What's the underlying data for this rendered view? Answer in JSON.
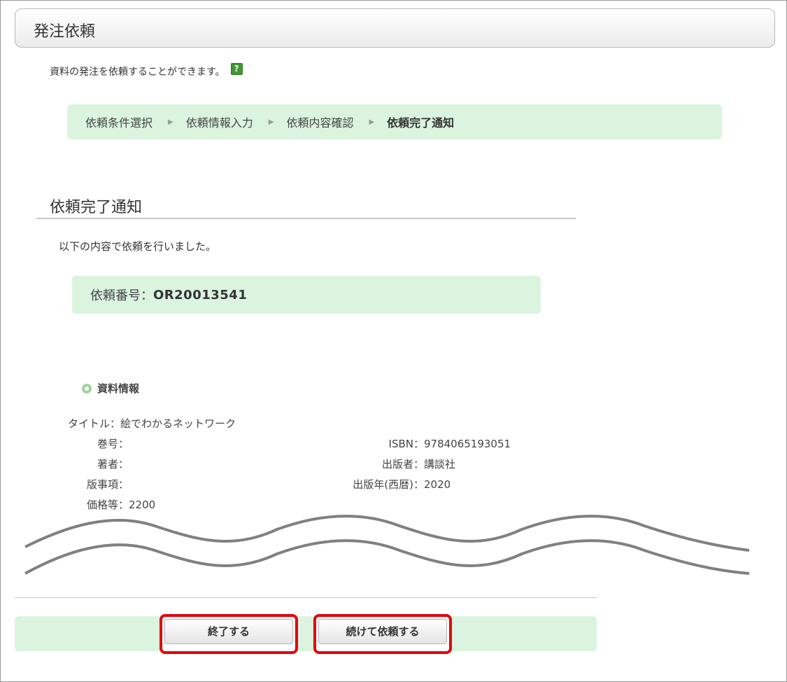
{
  "header": {
    "title": "発注依頼"
  },
  "intro": {
    "text": "資料の発注を依頼することができます。",
    "help_icon": "?"
  },
  "steps": [
    {
      "label": "依頼条件選択",
      "current": false
    },
    {
      "label": "依頼情報入力",
      "current": false
    },
    {
      "label": "依頼内容確認",
      "current": false
    },
    {
      "label": "依頼完了通知",
      "current": true
    }
  ],
  "step_arrow": "▶",
  "section": {
    "title": "依頼完了通知",
    "message": "以下の内容で依頼を行いました。"
  },
  "order": {
    "label": "依頼番号：",
    "number": "OR20013541"
  },
  "material": {
    "heading": "資料情報",
    "title_label": "タイトル：",
    "title_value": "絵でわかるネットワーク",
    "volume_label": "巻号：",
    "volume_value": "",
    "author_label": "著者：",
    "author_value": "",
    "edition_label": "版事項：",
    "edition_value": "",
    "price_label": "価格等：",
    "price_value": "2200",
    "isbn_label": "ISBN：",
    "isbn_value": "9784065193051",
    "publisher_label": "出版者：",
    "publisher_value": "講談社",
    "year_label": "出版年(西暦)：",
    "year_value": "2020"
  },
  "buttons": {
    "finish": "終了する",
    "continue": "続けて依頼する"
  },
  "colors": {
    "panel_green": "#daf4df",
    "highlight_red": "#e8000a",
    "help_green": "#3e9a2f"
  }
}
